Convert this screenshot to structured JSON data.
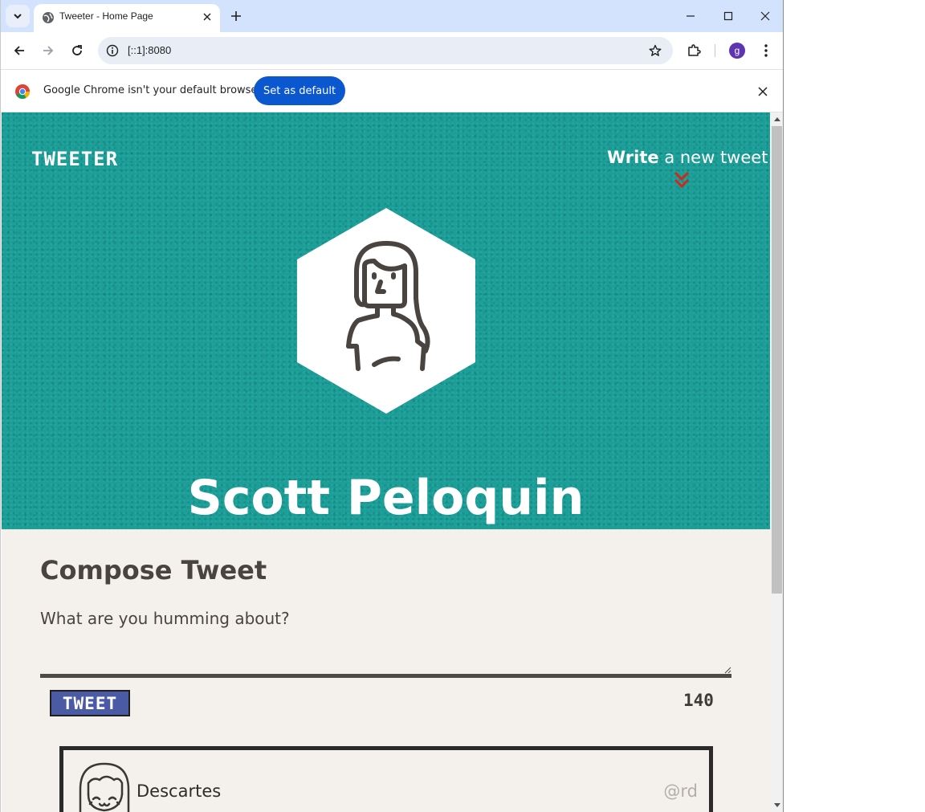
{
  "browser": {
    "tab_title": "Tweeter - Home Page",
    "url": "[::1]:8080",
    "profile_initial": "g",
    "infobar_message": "Google Chrome isn't your default browser",
    "infobar_button": "Set as default",
    "accent_color": "#0b57d0"
  },
  "page": {
    "brand": "TWEETER",
    "write_bold": "Write",
    "write_rest": " a new tweet",
    "user_name": "Scott Peloquin",
    "hero_color": "#1a9e97",
    "compose_title": "Compose Tweet",
    "compose_placeholder": "What are you humming about?",
    "tweet_button": "TWEET",
    "char_counter": "140",
    "tweets": [
      {
        "name": "Descartes",
        "handle": "@rd"
      }
    ]
  },
  "icons": {
    "tab_search": "chevron-down-icon",
    "favicon": "globe-icon",
    "write_arrow": "double-chevron-down-icon",
    "user_avatar": "woman-avatar-icon",
    "tweet_avatar": "girl-avatar-icon"
  }
}
